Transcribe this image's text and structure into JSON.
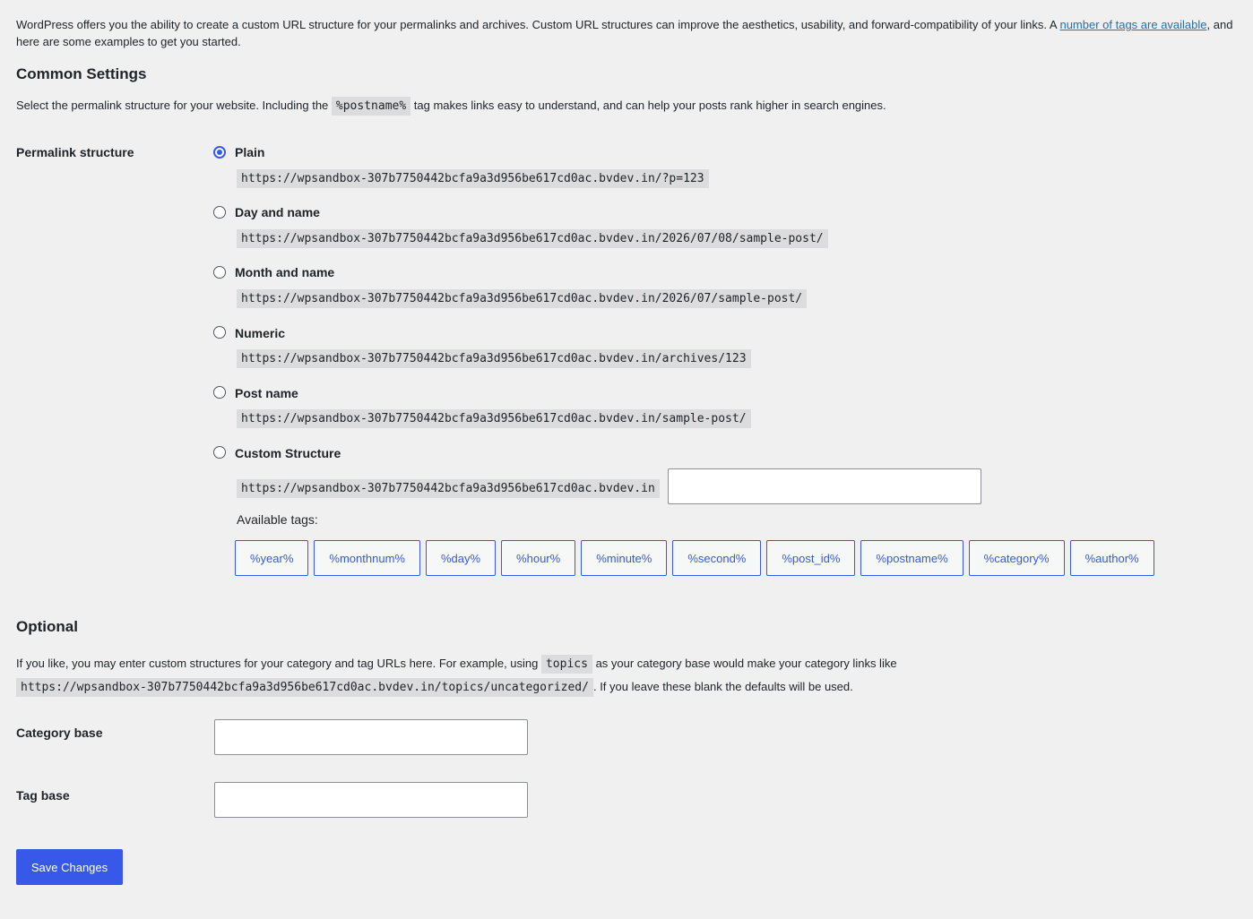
{
  "intro": {
    "text": "WordPress offers you the ability to create a custom URL structure for your permalinks and archives. Custom URL structures can improve the aesthetics, usability, and forward-compatibility of your links. A ",
    "link": "number of tags are available",
    "text_after": ", and here are some examples to get you started."
  },
  "common": {
    "heading": "Common Settings",
    "desc_before": "Select the permalink structure for your website. Including the ",
    "desc_code": "%postname%",
    "desc_after": " tag makes links easy to understand, and can help your posts rank higher in search engines.",
    "field_label": "Permalink structure",
    "options": [
      {
        "label": "Plain",
        "url": "https://wpsandbox-307b7750442bcfa9a3d956be617cd0ac.bvdev.in/?p=123",
        "checked": true
      },
      {
        "label": "Day and name",
        "url": "https://wpsandbox-307b7750442bcfa9a3d956be617cd0ac.bvdev.in/2026/07/08/sample-post/",
        "checked": false
      },
      {
        "label": "Month and name",
        "url": "https://wpsandbox-307b7750442bcfa9a3d956be617cd0ac.bvdev.in/2026/07/sample-post/",
        "checked": false
      },
      {
        "label": "Numeric",
        "url": "https://wpsandbox-307b7750442bcfa9a3d956be617cd0ac.bvdev.in/archives/123",
        "checked": false
      },
      {
        "label": "Post name",
        "url": "https://wpsandbox-307b7750442bcfa9a3d956be617cd0ac.bvdev.in/sample-post/",
        "checked": false
      },
      {
        "label": "Custom Structure",
        "url": "https://wpsandbox-307b7750442bcfa9a3d956be617cd0ac.bvdev.in",
        "checked": false
      }
    ],
    "custom_value": "",
    "available_tags_label": "Available tags:",
    "tags": [
      "%year%",
      "%monthnum%",
      "%day%",
      "%hour%",
      "%minute%",
      "%second%",
      "%post_id%",
      "%postname%",
      "%category%",
      "%author%"
    ]
  },
  "optional": {
    "heading": "Optional",
    "desc_before": "If you like, you may enter custom structures for your category and tag URLs here. For example, using ",
    "desc_code": "topics",
    "desc_mid": " as your category base would make your category links like ",
    "desc_code2": "https://wpsandbox-307b7750442bcfa9a3d956be617cd0ac.bvdev.in/topics/uncategorized/",
    "desc_after": ". If you leave these blank the defaults will be used.",
    "category_label": "Category base",
    "category_value": "",
    "tag_label": "Tag base",
    "tag_value": ""
  },
  "save_label": "Save Changes",
  "colors": {
    "accent": "#3858e9",
    "link": "#2271b1",
    "background": "#f0f0f1"
  }
}
